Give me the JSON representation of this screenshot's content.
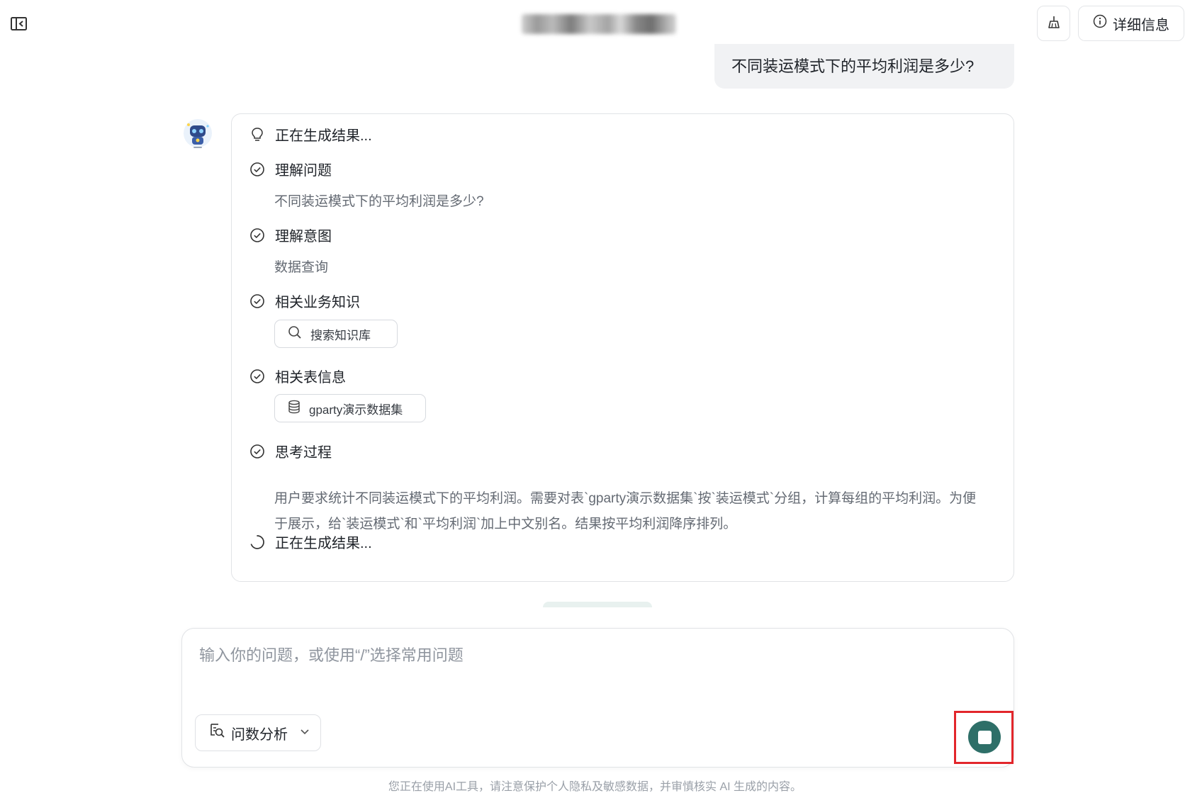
{
  "header": {
    "sidebar_toggle_icon": "sidebar-collapse-icon",
    "clean_icon": "broom-icon",
    "detail_label": "详细信息",
    "detail_icon": "info-icon"
  },
  "conversation": {
    "user_question": "不同装运模式下的平均利润是多少?",
    "avatar_icon": "robot-avatar-icon",
    "steps": [
      {
        "title": "正在生成结果...",
        "status": "thinking"
      },
      {
        "title": "理解问题",
        "status": "done",
        "detail": "不同装运模式下的平均利润是多少?"
      },
      {
        "title": "理解意图",
        "status": "done",
        "detail": "数据查询"
      },
      {
        "title": "相关业务知识",
        "status": "done",
        "chip_label": "搜索知识库",
        "chip_icon": "search-icon"
      },
      {
        "title": "相关表信息",
        "status": "done",
        "chip_label": "gparty演示数据集",
        "chip_icon": "database-icon"
      },
      {
        "title": "思考过程",
        "status": "done",
        "detail": "用户要求统计不同装运模式下的平均利润。需要对表`gparty演示数据集`按`装运模式`分组，计算每组的平均利润。为便于展示，给`装运模式`和`平均利润`加上中文别名。结果按平均利润降序排列。"
      },
      {
        "title": "正在生成结果...",
        "status": "loading"
      }
    ]
  },
  "input": {
    "placeholder": "输入你的问题，或使用“/”选择常用问题",
    "value": "",
    "mode_label": "问数分析",
    "mode_icon": "data-search-icon",
    "stop_icon": "stop-icon"
  },
  "footer": {
    "note": "您正在使用AI工具，请注意保护个人隐私及敏感数据，并审慎核实 AI 生成的内容。"
  },
  "colors": {
    "accent": "#2e6f68",
    "highlight_border": "#e2262b",
    "bubble_bg": "#f1f2f4"
  }
}
